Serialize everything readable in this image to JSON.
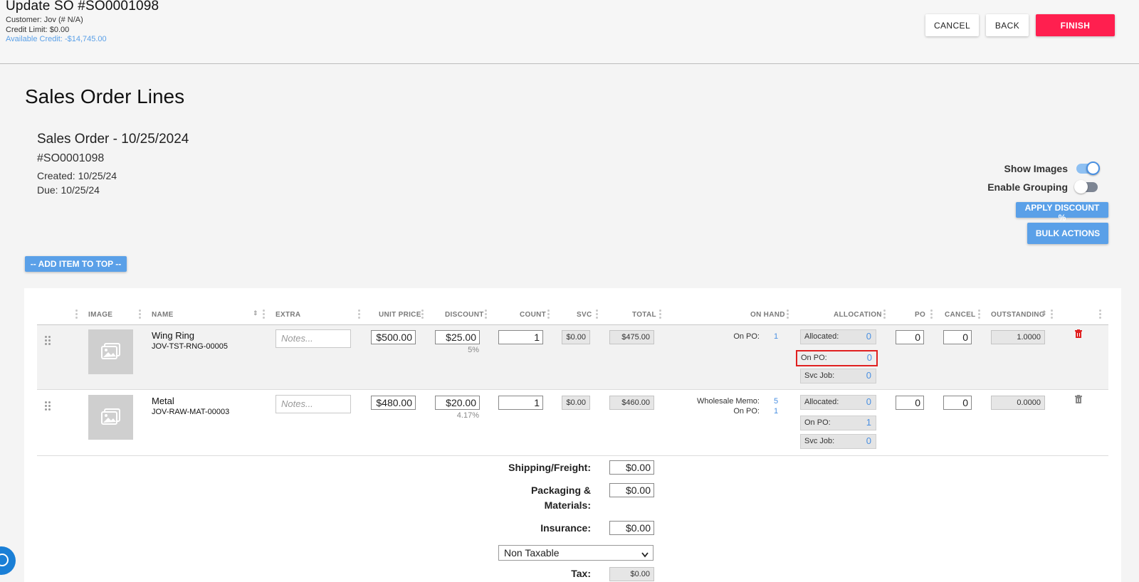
{
  "header": {
    "title": "Update SO #SO0001098",
    "customer": "Customer: Jov (# N/A)",
    "credit_limit": "Credit Limit: $0.00",
    "available_credit": "Available Credit: -$14,745.00",
    "cancel_label": "CANCEL",
    "back_label": "BACK",
    "finish_label": "FINISH"
  },
  "page_title": "Sales Order Lines",
  "order": {
    "heading": "Sales Order - 10/25/2024",
    "number": "#SO0001098",
    "created": "Created: 10/25/24",
    "due": "Due: 10/25/24"
  },
  "options": {
    "show_images_label": "Show Images",
    "show_images": true,
    "enable_grouping_label": "Enable Grouping",
    "enable_grouping": false,
    "apply_discount_label": "APPLY DISCOUNT %",
    "bulk_actions_label": "BULK ACTIONS",
    "add_item_label": "-- ADD ITEM TO TOP --"
  },
  "table": {
    "headers": {
      "image": "IMAGE",
      "name": "NAME",
      "extra": "EXTRA",
      "unit_price": "UNIT PRICE",
      "discount": "DISCOUNT",
      "count": "COUNT",
      "svc": "SVC",
      "total": "TOTAL",
      "on_hand": "ON HAND",
      "allocation": "ALLOCATION",
      "po": "PO",
      "cancel": "CANCEL",
      "outstanding": "OUTSTANDING"
    },
    "notes_placeholder": "Notes...",
    "alloc_labels": {
      "allocated": "Allocated:",
      "on_po": "On PO:",
      "svc_job": "Svc Job:"
    },
    "rows": [
      {
        "name": "Wing Ring",
        "sku": "JOV-TST-RNG-00005",
        "unit_price": "$500.00",
        "discount": "$25.00",
        "discount_pct": "5%",
        "count": "1",
        "svc": "$0.00",
        "total": "$475.00",
        "on_hand": [
          {
            "label": "On PO:",
            "value": "1"
          }
        ],
        "allocated": "0",
        "on_po": "0",
        "svc_job": "0",
        "po": "0",
        "cancel": "0",
        "outstanding": "1.0000"
      },
      {
        "name": "Metal",
        "sku": "JOV-RAW-MAT-00003",
        "unit_price": "$480.00",
        "discount": "$20.00",
        "discount_pct": "4.17%",
        "count": "1",
        "svc": "$0.00",
        "total": "$460.00",
        "on_hand": [
          {
            "label": "Wholesale Memo:",
            "value": "5"
          },
          {
            "label": "On PO:",
            "value": "1"
          }
        ],
        "allocated": "0",
        "on_po": "1",
        "svc_job": "0",
        "po": "0",
        "cancel": "0",
        "outstanding": "0.0000"
      }
    ]
  },
  "footer": {
    "shipping_label": "Shipping/Freight:",
    "shipping": "$0.00",
    "packaging_label_1": "Packaging &",
    "packaging_label_2": "Materials:",
    "packaging": "$0.00",
    "insurance_label": "Insurance:",
    "insurance": "$0.00",
    "tax_option": "Non Taxable",
    "tax_label": "Tax:",
    "tax": "$0.00"
  },
  "colors": {
    "finish": "#ff1f4f",
    "blue_button": "#5aa0e8",
    "link_blue": "#4a90e2",
    "highlight": "#e02020"
  },
  "icons": [
    "drag-handle-icon",
    "image-placeholder-icon",
    "trash-icon",
    "chevron-down-icon",
    "help-chat-icon"
  ]
}
